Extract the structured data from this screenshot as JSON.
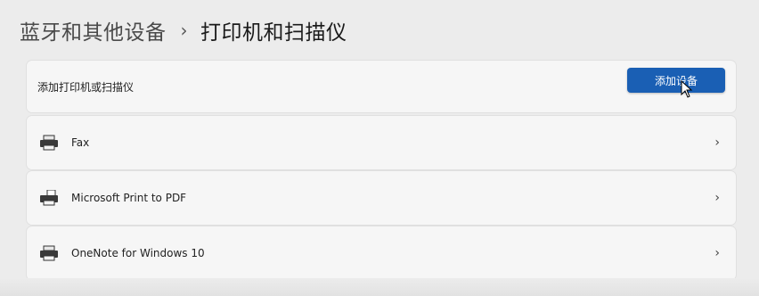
{
  "header": {
    "parent": "蓝牙和其他设备",
    "separator": "›",
    "current": "打印机和扫描仪"
  },
  "add_section": {
    "label": "添加打印机或扫描仪",
    "button_label": "添加设备"
  },
  "printers": [
    {
      "name": "Fax",
      "icon": "printer-icon",
      "chevron": "›"
    },
    {
      "name": "Microsoft Print to PDF",
      "icon": "pdf-printer-icon",
      "chevron": "›"
    },
    {
      "name": "OneNote for Windows 10",
      "icon": "printer-icon",
      "chevron": "›"
    }
  ],
  "colors": {
    "accent": "#1a5fb4",
    "background": "#ececec",
    "card": "#f6f6f6"
  }
}
